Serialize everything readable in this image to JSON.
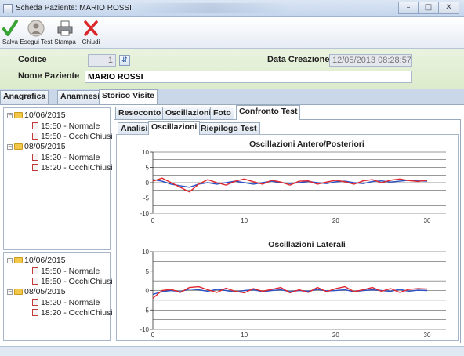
{
  "window": {
    "title": "Scheda Paziente: MARIO ROSSI",
    "min": "–",
    "max": "□",
    "close": "✕"
  },
  "toolbar": {
    "buttons": [
      {
        "label": "Salva",
        "icon": "check-icon"
      },
      {
        "label": "Esegui Test",
        "icon": "person-icon"
      },
      {
        "label": "Stampa",
        "icon": "printer-icon"
      },
      {
        "label": "Chiudi",
        "icon": "close-x-icon"
      }
    ]
  },
  "header": {
    "codice_label": "Codice",
    "codice_value": "1",
    "data_creazione_label": "Data Creazione",
    "data_creazione_value": "12/05/2013 08:28:57",
    "nome_label": "Nome Paziente",
    "nome_value": "MARIO ROSSI"
  },
  "main_tabs": [
    "Anagrafica",
    "Anamnesi",
    "Storico Visite"
  ],
  "trees": [
    {
      "groups": [
        {
          "date": "10/06/2015",
          "items": [
            "15:50 - Normale",
            "15:50 - OcchiChiusi"
          ]
        },
        {
          "date": "08/05/2015",
          "items": [
            "18:20 - Normale",
            "18:20 - OcchiChiusi"
          ]
        }
      ]
    },
    {
      "groups": [
        {
          "date": "10/06/2015",
          "items": [
            "15:50 - Normale",
            "15:50 - OcchiChiusi"
          ]
        },
        {
          "date": "08/05/2015",
          "items": [
            "18:20 - Normale",
            "18:20 - OcchiChiusi"
          ]
        }
      ]
    }
  ],
  "visit_tabs": [
    "Resoconto",
    "Oscillazioni",
    "Foto",
    "Confronto Test"
  ],
  "sub_tabs": [
    "Analisi",
    "Oscillazioni",
    "Riepilogo Test"
  ],
  "colors": {
    "series_a": "#2b52c4",
    "series_b": "#e0262e"
  },
  "chart_data": [
    {
      "type": "line",
      "title": "Oscillazioni Antero/Posteriori",
      "xlim": [
        0,
        30
      ],
      "ylim": [
        -10,
        10
      ],
      "xticks": [
        0,
        10,
        20,
        30
      ],
      "yticks": [
        10,
        5,
        0,
        -5,
        -10
      ],
      "grid": true,
      "x": [
        0,
        1,
        2,
        3,
        4,
        5,
        6,
        7,
        8,
        9,
        10,
        11,
        12,
        13,
        14,
        15,
        16,
        17,
        18,
        19,
        20,
        21,
        22,
        23,
        24,
        25,
        26,
        27,
        28,
        29,
        30
      ],
      "series": [
        {
          "values": [
            1,
            0.5,
            -0.5,
            -1,
            -1.5,
            -0.5,
            0,
            -0.5,
            0,
            0.5,
            0,
            -0.5,
            0,
            0.5,
            0,
            -0.3,
            0,
            0.4,
            0,
            -0.3,
            0.3,
            0.5,
            0,
            -0.3,
            0.4,
            0.6,
            0.2,
            0.5,
            0.8,
            0.6,
            0.5
          ]
        },
        {
          "values": [
            0.5,
            1.5,
            0,
            -1.5,
            -3,
            -0.5,
            1,
            0,
            -0.8,
            0.5,
            1.2,
            0.3,
            -0.5,
            0.8,
            0.2,
            -0.8,
            0.5,
            0.6,
            -0.5,
            0.2,
            0.8,
            0.3,
            -0.5,
            0.6,
            1,
            0,
            0.8,
            1.2,
            0.7,
            0.4,
            0.8
          ]
        }
      ]
    },
    {
      "type": "line",
      "title": "Oscillazioni Laterali",
      "xlim": [
        0,
        30
      ],
      "ylim": [
        -10,
        10
      ],
      "xticks": [
        0,
        10,
        20,
        30
      ],
      "yticks": [
        10,
        5,
        0,
        -5,
        -10
      ],
      "grid": true,
      "x": [
        0,
        1,
        2,
        3,
        4,
        5,
        6,
        7,
        8,
        9,
        10,
        11,
        12,
        13,
        14,
        15,
        16,
        17,
        18,
        19,
        20,
        21,
        22,
        23,
        24,
        25,
        26,
        27,
        28,
        29,
        30
      ],
      "series": [
        {
          "values": [
            -1,
            -0.3,
            0,
            -0.3,
            0.4,
            0.2,
            -0.2,
            0.3,
            0,
            -0.4,
            0,
            0.2,
            -0.3,
            0,
            0.2,
            -0.3,
            0,
            -0.2,
            0.3,
            -0.1,
            0,
            0.2,
            -0.3,
            0,
            0.2,
            0,
            -0.2,
            0.3,
            -0.2,
            0.1,
            0
          ]
        },
        {
          "values": [
            -2,
            0,
            0.3,
            -0.5,
            0.8,
            1,
            0.2,
            -0.5,
            0.6,
            -0.2,
            -0.6,
            0.5,
            -0.2,
            0.3,
            0.8,
            -0.6,
            0.2,
            -0.5,
            0.8,
            -0.3,
            0.5,
            1,
            -0.3,
            0.2,
            0.8,
            -0.2,
            0.5,
            -0.5,
            0.3,
            0.5,
            0.4
          ]
        }
      ]
    }
  ]
}
